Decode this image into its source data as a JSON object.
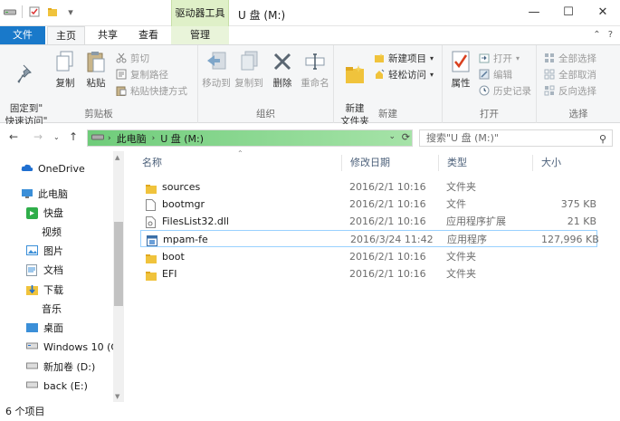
{
  "titlebar": {
    "context_tab": "驱动器工具",
    "title": "U 盘 (M:)",
    "minimize": "—",
    "maximize": "☐",
    "close": "✕"
  },
  "tabs": {
    "file": "文件",
    "home": "主页",
    "share": "共享",
    "view": "查看",
    "manage": "管理"
  },
  "ribbon": {
    "clipboard": {
      "label": "剪贴板",
      "pin": "固定到\"\n快速访问\"",
      "copy": "复制",
      "paste": "粘贴",
      "cut": "剪切",
      "copy_path": "复制路径",
      "paste_shortcut": "粘贴快捷方式"
    },
    "organize": {
      "label": "组织",
      "move_to": "移动到",
      "copy_to": "复制到",
      "delete": "删除",
      "rename": "重命名"
    },
    "new": {
      "label": "新建",
      "new_folder": "新建\n文件夹",
      "new_item": "新建项目",
      "easy_access": "轻松访问"
    },
    "open": {
      "label": "打开",
      "properties": "属性",
      "open": "打开",
      "edit": "编辑",
      "history": "历史记录"
    },
    "select": {
      "label": "选择",
      "select_all": "全部选择",
      "select_none": "全部取消",
      "invert": "反向选择"
    }
  },
  "address": {
    "crumbs": [
      "此电脑",
      "U 盘 (M:)"
    ],
    "search_placeholder": "搜索\"U 盘 (M:)\""
  },
  "navpane": {
    "items": [
      {
        "label": "OneDrive",
        "icon": "cloud-icon"
      },
      {
        "label": "此电脑",
        "icon": "computer-icon"
      },
      {
        "label": "快盘",
        "icon": "kuaipan-icon"
      },
      {
        "label": "视频",
        "icon": "none"
      },
      {
        "label": "图片",
        "icon": "pictures-icon"
      },
      {
        "label": "文档",
        "icon": "documents-icon"
      },
      {
        "label": "下载",
        "icon": "download-icon"
      },
      {
        "label": "音乐",
        "icon": "none"
      },
      {
        "label": "桌面",
        "icon": "desktop-icon"
      },
      {
        "label": "Windows 10 (C",
        "icon": "drive-icon"
      },
      {
        "label": "新加卷 (D:)",
        "icon": "drive-icon"
      },
      {
        "label": "back (E:)",
        "icon": "drive-icon"
      }
    ]
  },
  "filelist": {
    "columns": [
      "名称",
      "修改日期",
      "类型",
      "大小"
    ],
    "rows": [
      {
        "name": "sources",
        "date": "2016/2/1 10:16",
        "type": "文件夹",
        "size": "",
        "icon": "folder-icon"
      },
      {
        "name": "bootmgr",
        "date": "2016/2/1 10:16",
        "type": "文件",
        "size": "375 KB",
        "icon": "file-icon"
      },
      {
        "name": "FilesList32.dll",
        "date": "2016/2/1 10:16",
        "type": "应用程序扩展",
        "size": "21 KB",
        "icon": "dll-icon"
      },
      {
        "name": "mpam-fe",
        "date": "2016/3/24 11:42",
        "type": "应用程序",
        "size": "127,996 KB",
        "icon": "exe-icon"
      },
      {
        "name": "boot",
        "date": "2016/2/1 10:16",
        "type": "文件夹",
        "size": "",
        "icon": "folder-icon"
      },
      {
        "name": "EFI",
        "date": "2016/2/1 10:16",
        "type": "文件夹",
        "size": "",
        "icon": "folder-icon"
      }
    ]
  },
  "status": {
    "count": "6 个项目"
  },
  "colors": {
    "accent": "#1979ca",
    "address_green": "#6fcc7a",
    "folder": "#f0c33c"
  }
}
